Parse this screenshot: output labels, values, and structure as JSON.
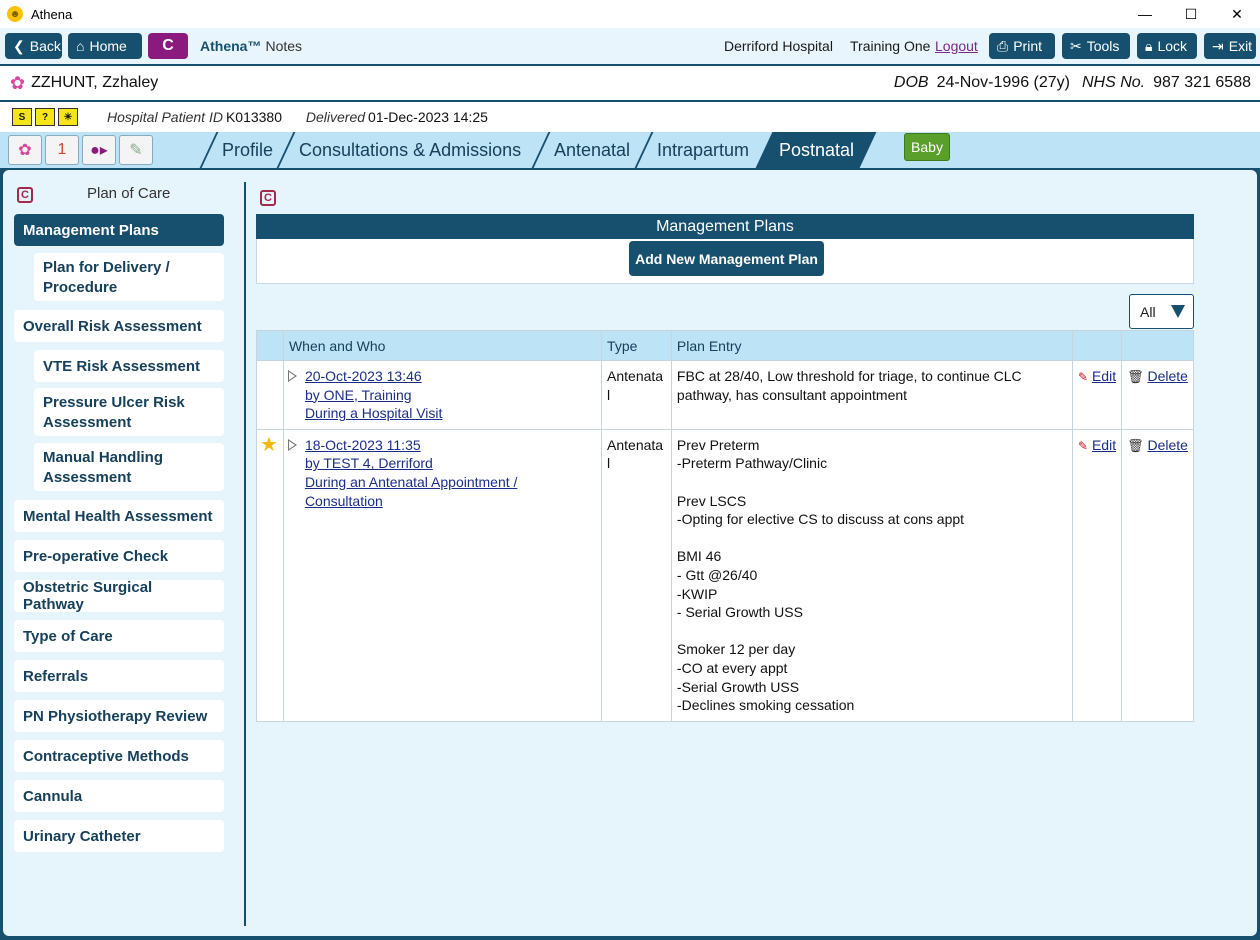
{
  "window": {
    "title": "Athena",
    "minimize": "—",
    "maximize": "☐",
    "close": "✕"
  },
  "topbar": {
    "back": "Back",
    "home": "Home",
    "c": "C",
    "brand": "Athena™",
    "brand_suffix": "Notes",
    "hospital": "Derriford Hospital",
    "user": "Training One",
    "logout": "Logout",
    "print": "Print",
    "tools": "Tools",
    "lock": "Lock",
    "exit": "Exit"
  },
  "patient": {
    "name": "ZZHUNT, Zzhaley",
    "dob_label": "DOB",
    "dob": "24-Nov-1996 (27y)",
    "nhs_label": "NHS No.",
    "nhs": "987 321 6588",
    "hospital_id_label": "Hospital Patient ID",
    "hospital_id": "K013380",
    "delivered_label": "Delivered",
    "delivered": "01-Dec-2023 14:25"
  },
  "mini_icons": [
    "S",
    "?",
    "☀"
  ],
  "tool_icons": [
    "✿",
    "1",
    "●▸",
    "✎"
  ],
  "tabs": {
    "profile": "Profile",
    "consultations": "Consultations & Admissions",
    "antenatal": "Antenatal",
    "intrapartum": "Intrapartum",
    "postnatal": "Postnatal",
    "baby": "Baby"
  },
  "sidebar": {
    "title": "Plan of Care",
    "c_icon": "C",
    "items": {
      "management_plans": "Management Plans",
      "plan_for_delivery_1": "Plan for Delivery /",
      "plan_for_delivery_2": "Procedure",
      "overall_risk": "Overall Risk Assessment",
      "vte_risk": "VTE Risk Assessment",
      "pressure_ulcer_1": "Pressure Ulcer Risk",
      "pressure_ulcer_2": "Assessment",
      "manual_handling_1": "Manual Handling",
      "manual_handling_2": "Assessment",
      "mental_health": "Mental Health Assessment",
      "preop": "Pre-operative Check",
      "obstetric_surgical": "Obstetric Surgical Pathway",
      "type_of_care": "Type of Care",
      "referrals": "Referrals",
      "pn_physio": "PN Physiotherapy Review",
      "contraceptive": "Contraceptive Methods",
      "cannula": "Cannula",
      "urinary": "Urinary Catheter"
    }
  },
  "content": {
    "c_icon": "C",
    "panel_title": "Management Plans",
    "add_button": "Add New Management Plan",
    "filter_value": "All",
    "columns": {
      "when_who": "When and Who",
      "type": "Type",
      "plan_entry": "Plan Entry"
    },
    "rows": [
      {
        "date": "20-Oct-2023 13:46",
        "by": "by ONE, Training",
        "context": "During a Hospital Visit",
        "type_1": "Antenata",
        "type_2": "l",
        "entry": "FBC at 28/40, Low threshold for triage, to continue CLC\npathway, has consultant appointment",
        "edit": "Edit",
        "delete": "Delete"
      },
      {
        "date": "18-Oct-2023 11:35",
        "by": "by TEST 4, Derriford",
        "context": "During an Antenatal Appointment / Consultation",
        "type_1": "Antenata",
        "type_2": "l",
        "entry": "Prev Preterm\n-Preterm Pathway/Clinic\n\nPrev LSCS\n-Opting for elective CS to discuss at cons appt\n\nBMI 46\n- Gtt @26/40\n-KWIP\n- Serial Growth USS\n\nSmoker 12 per day\n-CO at every appt\n-Serial Growth USS\n-Declines smoking cessation",
        "edit": "Edit",
        "delete": "Delete"
      }
    ]
  }
}
